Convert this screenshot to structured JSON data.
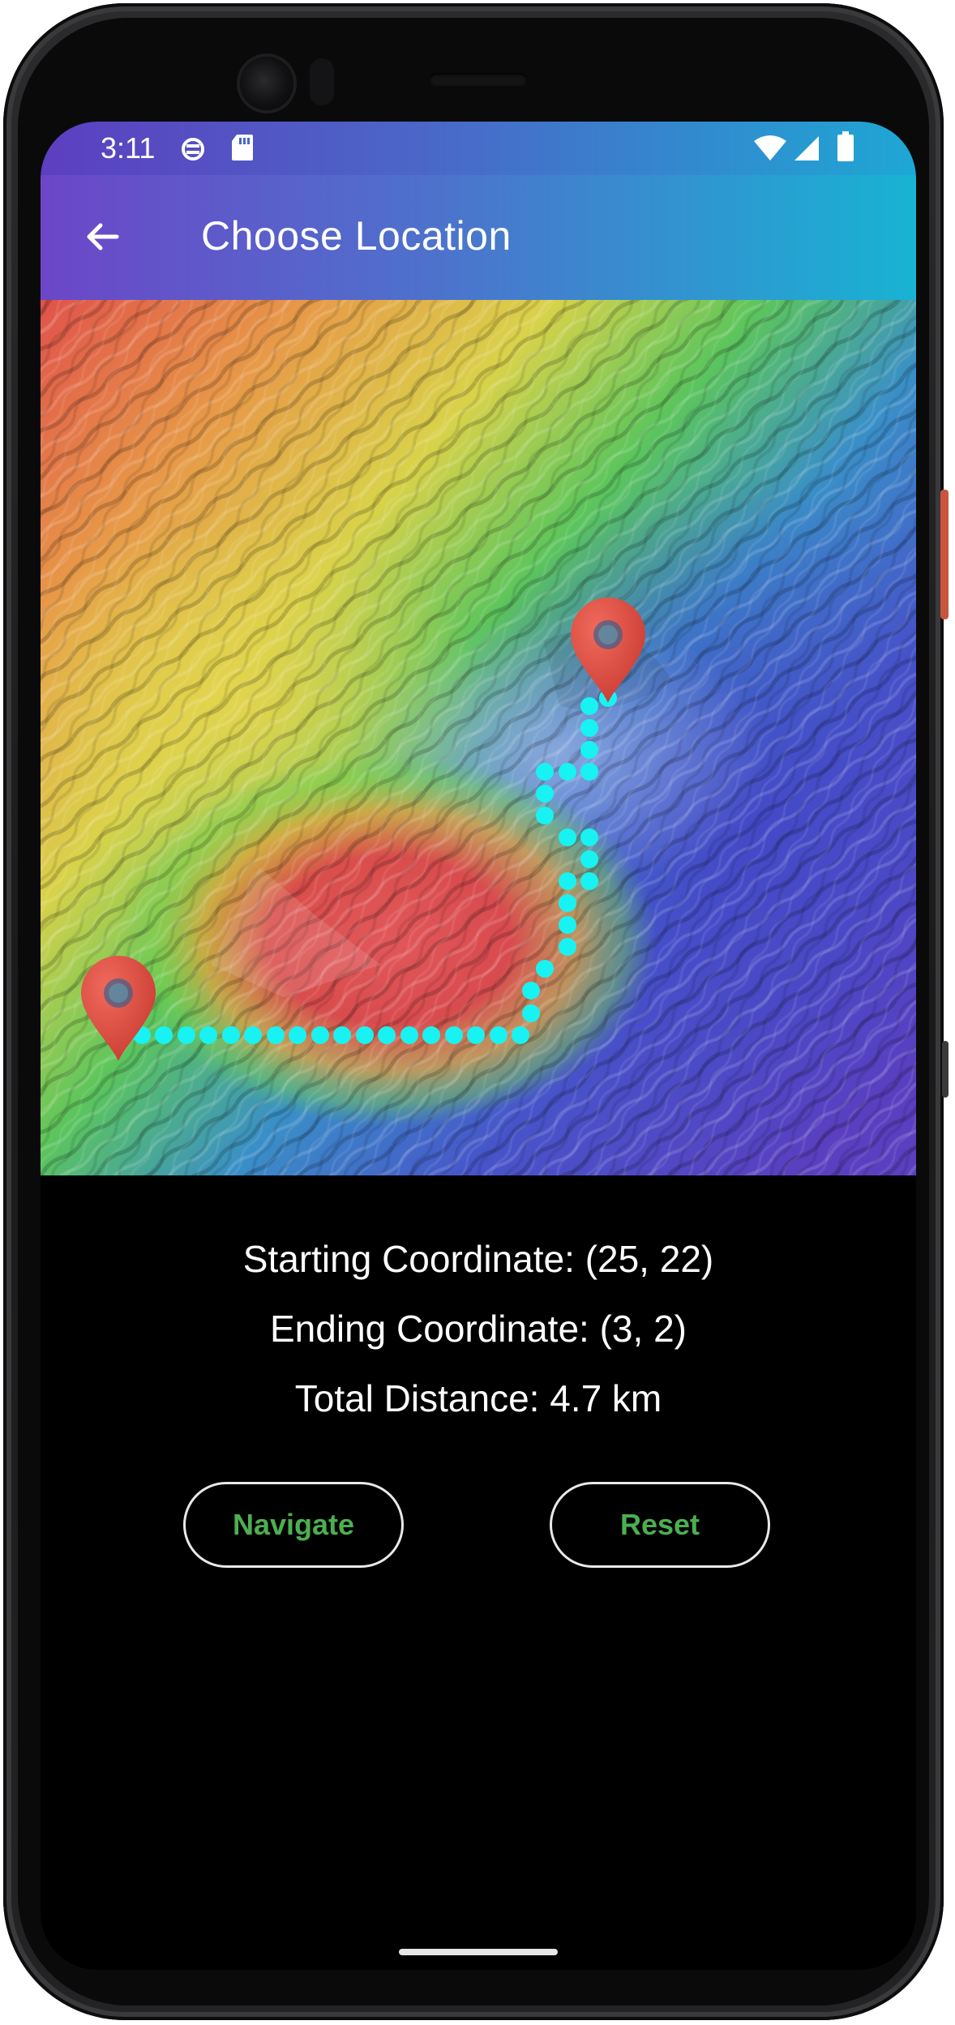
{
  "status_bar": {
    "time": "3:11",
    "icons": [
      "vpn-key-icon",
      "sd-card-icon",
      "wifi-icon",
      "signal-icon",
      "battery-icon"
    ]
  },
  "app_bar": {
    "title": "Choose Location",
    "back_icon": "arrow-back-icon",
    "gradient": [
      "#6c46c8",
      "#4d72cc",
      "#18b3d3"
    ]
  },
  "map": {
    "type": "terrain-heatmap",
    "start_marker": "location-pin-icon",
    "end_marker": "location-pin-icon",
    "path_color": "#19f2f2",
    "marker_color": "#e2463b"
  },
  "info": {
    "starting": "Starting Coordinate: (25, 22)",
    "ending": "Ending Coordinate: (3, 2)",
    "distance": "Total Distance: 4.7 km"
  },
  "buttons": {
    "navigate_label": "Navigate",
    "reset_label": "Reset",
    "label_color": "#4caf50"
  }
}
